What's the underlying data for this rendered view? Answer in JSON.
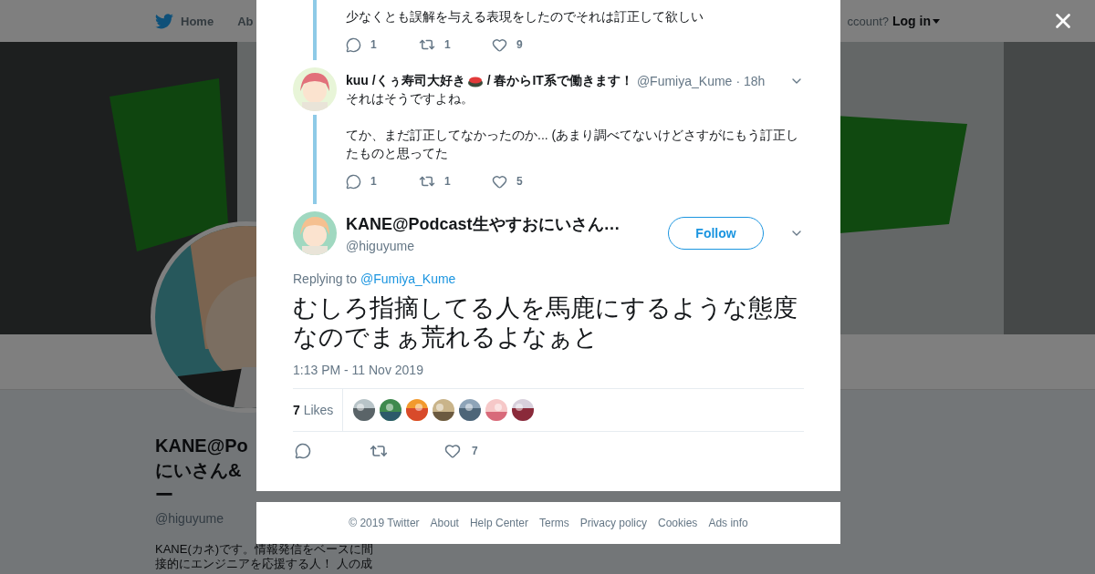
{
  "top_nav": {
    "items": [
      {
        "label": "Home",
        "selected": false
      },
      {
        "label": "Ab",
        "selected": false
      }
    ],
    "account_prompt": "ccount?",
    "login": "Log in"
  },
  "profile": {
    "name_lines": [
      "KANE@Po",
      "にいさん&",
      "ー"
    ],
    "handle": "@higuyume",
    "bio_lines": [
      "KANE(カネ)です。情報発信をベースに間",
      "接的にエンジニアを応援する人！ 人の成"
    ]
  },
  "thread": [
    {
      "kind": "cut",
      "paragraphs": [
        "少なくとも誤解を与える表現をしたのでそれは訂正して欲しい"
      ],
      "replies": "1",
      "retweets": "1",
      "likes": "9"
    },
    {
      "kind": "reply",
      "name_start": "kuu /くぅ寿司大好き",
      "name_end": "/ 春からIT系で働きます！",
      "handle": "@Fumiya_Kume",
      "time": "· 18h",
      "paragraphs": [
        "それはそうですよね。",
        "てか、まだ訂正してなかったのか... (あまり調べてないけどさすがにもう訂正したものと思ってた"
      ],
      "replies": "1",
      "retweets": "1",
      "likes": "5"
    }
  ],
  "tweet": {
    "name": "KANE@Podcast生やすおにいさん…",
    "handle": "@higuyume",
    "follow": "Follow",
    "replying_prefix": "Replying to",
    "replying_to": "@Fumiya_Kume",
    "text": "むしろ指摘してる人を馬鹿にするような態度なのでまぁ荒れるよなぁと",
    "time": "1:13 PM - 11 Nov 2019",
    "likes_count": "7",
    "likes_label": "Likes",
    "likes": "7"
  },
  "footer": [
    "© 2019 Twitter",
    "About",
    "Help Center",
    "Terms",
    "Privacy policy",
    "Cookies",
    "Ads info"
  ]
}
